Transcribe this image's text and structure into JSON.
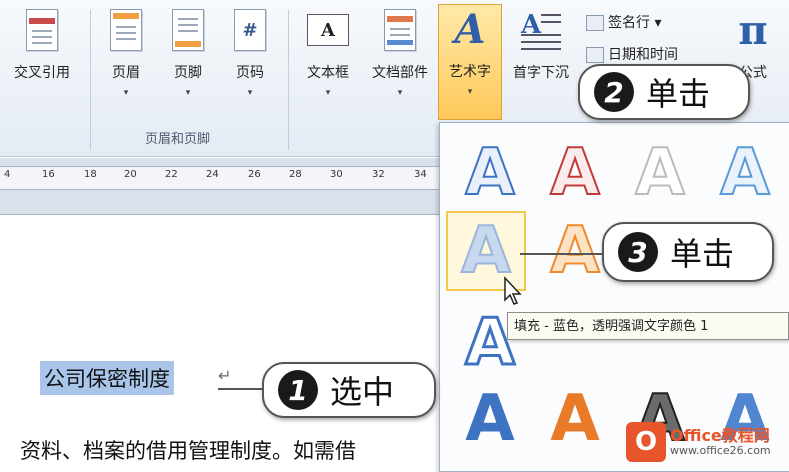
{
  "ribbon": {
    "buttons": [
      {
        "label": "交叉引用",
        "icon": "cross-reference-icon"
      },
      {
        "label": "页眉",
        "icon": "header-icon",
        "arrow": "▾"
      },
      {
        "label": "页脚",
        "icon": "footer-icon",
        "arrow": "▾"
      },
      {
        "label": "页码",
        "icon": "page-number-icon",
        "glyph": "#",
        "arrow": "▾"
      },
      {
        "label": "文本框",
        "icon": "text-box-icon",
        "glyph": "A",
        "arrow": "▾"
      },
      {
        "label": "文档部件",
        "icon": "quick-parts-icon",
        "arrow": "▾"
      },
      {
        "label": "艺术字",
        "icon": "wordart-icon",
        "glyph": "A",
        "arrow": "▾"
      },
      {
        "label": "首字下沉",
        "icon": "drop-cap-icon",
        "glyph": "A"
      },
      {
        "label": "公式",
        "icon": "equation-icon",
        "glyph": "π"
      }
    ],
    "small_buttons": [
      {
        "label": "签名行 ▾",
        "icon": "signature-line-icon"
      },
      {
        "label": "日期和时间",
        "icon": "date-time-icon"
      }
    ],
    "group_label": "页眉和页脚"
  },
  "ruler": {
    "ticks": [
      "4",
      "16",
      "18",
      "20",
      "22",
      "24",
      "26",
      "28",
      "30",
      "32",
      "34"
    ]
  },
  "document": {
    "selected_text": "公司保密制度",
    "paragraph_mark": "↵",
    "body_line": "资料、档案的借用管理制度。如需借"
  },
  "gallery": {
    "accent_colors": {
      "blue": "#3e73c2",
      "orange": "#f08a2c",
      "red": "#c23a3a",
      "gray": "#8b8b8b"
    },
    "glyph": "A",
    "tooltip": "填充 - 蓝色，透明强调文字颜色 1"
  },
  "callouts": [
    {
      "num": "1",
      "text": "选中"
    },
    {
      "num": "2",
      "text": "单击"
    },
    {
      "num": "3",
      "text": "单击"
    }
  ],
  "watermark": {
    "logo": "O",
    "name": "Office教程网",
    "url": "www.office26.com"
  }
}
